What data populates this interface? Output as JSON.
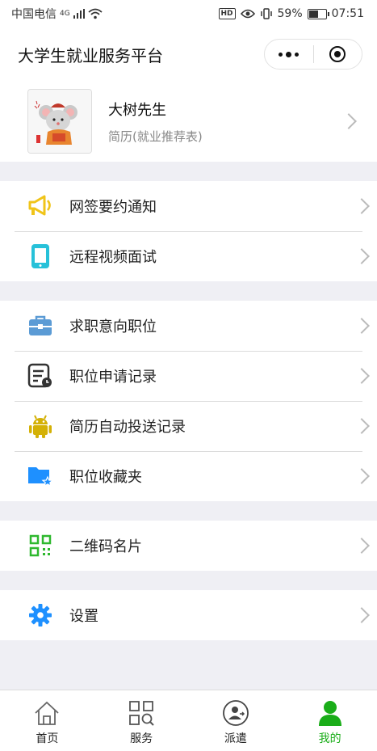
{
  "status_bar": {
    "carrier": "中国电信",
    "network": "4G",
    "hd": "HD",
    "battery": "59%",
    "time": "07:51"
  },
  "nav": {
    "title": "大学生就业服务平台"
  },
  "profile": {
    "name": "大树先生",
    "subtitle": "简历(就业推荐表)"
  },
  "groups": [
    {
      "items": [
        {
          "label": "网签要约通知",
          "icon": "megaphone-icon",
          "color": "#f0c419"
        },
        {
          "label": "远程视频面试",
          "icon": "tablet-icon",
          "color": "#27c1d9"
        }
      ]
    },
    {
      "items": [
        {
          "label": "求职意向职位",
          "icon": "briefcase-icon",
          "color": "#5b9bd5"
        },
        {
          "label": "职位申请记录",
          "icon": "record-clock-icon",
          "color": "#333333"
        },
        {
          "label": "简历自动投送记录",
          "icon": "android-icon",
          "color": "#d4b106"
        },
        {
          "label": "职位收藏夹",
          "icon": "star-folder-icon",
          "color": "#1e90ff"
        }
      ]
    },
    {
      "items": [
        {
          "label": "二维码名片",
          "icon": "qrcode-icon",
          "color": "#2eb82e"
        }
      ]
    },
    {
      "items": [
        {
          "label": "设置",
          "icon": "gear-icon",
          "color": "#1e90ff"
        }
      ]
    }
  ],
  "tabs": [
    {
      "label": "首页",
      "icon": "home-icon"
    },
    {
      "label": "服务",
      "icon": "grid-search-icon"
    },
    {
      "label": "派遣",
      "icon": "dispatch-icon"
    },
    {
      "label": "我的",
      "icon": "user-icon",
      "active": true
    }
  ]
}
